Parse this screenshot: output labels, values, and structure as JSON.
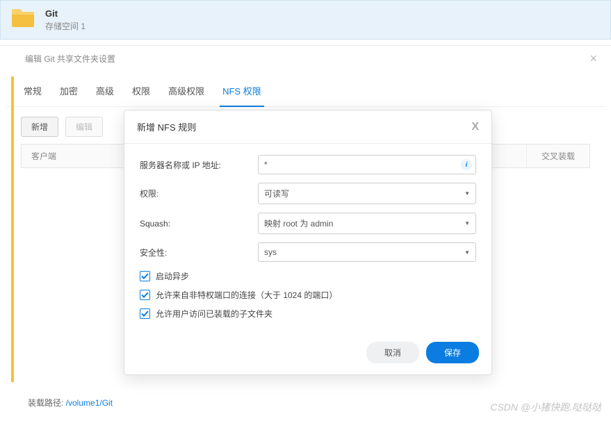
{
  "header": {
    "title": "Git",
    "subtitle": "存储空间 1"
  },
  "panel": {
    "title": "编辑 Git 共享文件夹设置"
  },
  "tabs": [
    "常规",
    "加密",
    "高级",
    "权限",
    "高级权限",
    "NFS 权限"
  ],
  "active_tab_index": 5,
  "toolbar": {
    "add": "新增",
    "edit": "编辑"
  },
  "grid": {
    "col_client": "客户端",
    "col_cross": "交叉装载"
  },
  "mount": {
    "label": "装载路径: ",
    "path": "/volume1/Git"
  },
  "modal": {
    "title": "新增 NFS 规则",
    "labels": {
      "host": "服务器名称或 IP 地址:",
      "perm": "权限:",
      "squash": "Squash:",
      "security": "安全性:"
    },
    "values": {
      "host": "*",
      "perm": "可读写",
      "squash": "映射 root 为 admin",
      "security": "sys"
    },
    "checks": {
      "async": "启动异步",
      "nonpriv": "允许来自非特权端口的连接（大于 1024 的端口）",
      "subfolders": "允许用户访问已装载的子文件夹"
    },
    "buttons": {
      "cancel": "取消",
      "save": "保存"
    }
  },
  "watermark": "CSDN @小猪快跑.哒哒哒"
}
